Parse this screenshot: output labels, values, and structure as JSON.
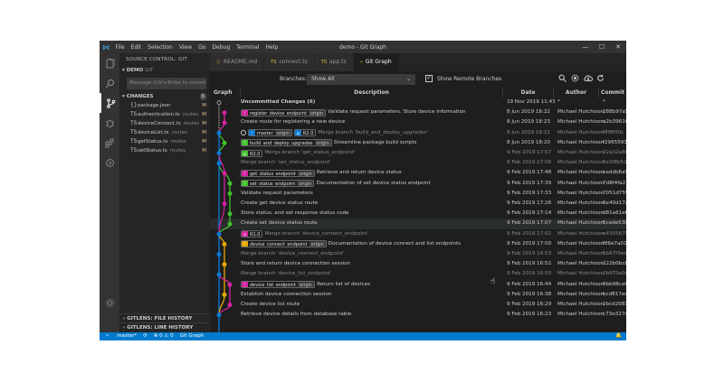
{
  "window": {
    "title": "demo - Git Graph",
    "menu": [
      "File",
      "Edit",
      "Selection",
      "View",
      "Go",
      "Debug",
      "Terminal",
      "Help"
    ],
    "controls": {
      "minimize": "—",
      "maximize": "☐",
      "close": "✕"
    }
  },
  "sidebar": {
    "header": "SOURCE CONTROL: GIT",
    "repo": "DEMO",
    "repo_scm": "GIT",
    "message_placeholder": "Message (Ctrl+Enter to commit",
    "changes_label": "CHANGES",
    "changes_count": "6",
    "files": [
      {
        "name": "package.json",
        "dir": "",
        "status": "M",
        "icon": "{}"
      },
      {
        "name": "authentication.ts",
        "dir": "routes",
        "status": "M",
        "icon": "TS"
      },
      {
        "name": "deviceConnect.ts",
        "dir": "routes",
        "status": "M",
        "icon": "TS"
      },
      {
        "name": "deviceList.ts",
        "dir": "routes",
        "status": "M",
        "icon": "TS"
      },
      {
        "name": "getStatus.ts",
        "dir": "routes",
        "status": "M",
        "icon": "TS"
      },
      {
        "name": "setStatus.ts",
        "dir": "routes",
        "status": "M",
        "icon": "TS"
      }
    ],
    "file_history": "GITLENS: FILE HISTORY",
    "line_history": "GITLENS: LINE HISTORY"
  },
  "tabs": [
    {
      "label": "README.md",
      "icon": "ⓘ",
      "active": false
    },
    {
      "label": "connect.ts",
      "icon": "TS",
      "active": false
    },
    {
      "label": "app.ts",
      "icon": "TS",
      "active": false
    },
    {
      "label": "Git Graph",
      "icon": "⑂",
      "active": true
    }
  ],
  "toolbar": {
    "branches_label": "Branches:",
    "branches_value": "Show All",
    "show_remote_label": "Show Remote Branches",
    "show_remote_checked": "✓"
  },
  "columns": {
    "graph": "Graph",
    "description": "Description",
    "date": "Date",
    "author": "Author",
    "commit": "Commit"
  },
  "colors": {
    "accent": "#007acc",
    "magenta": "#d4229f",
    "green": "#43c02e",
    "yellow": "#e6a700",
    "blue": "#0a7ad6",
    "gray": "#9e9e9e"
  },
  "commits": [
    {
      "desc": "Uncommitted Changes (6)",
      "date": "19 Nov 2019 11:43",
      "author": "*",
      "commit": "*",
      "refs": [],
      "bold": true,
      "dim": false
    },
    {
      "desc": "Validate request parameters. Store device information",
      "date": "8 Jun 2019 18:22",
      "author": "Michael Hutchison",
      "commit": "288b97a5",
      "refs": [
        {
          "name": "register_device_endpoint",
          "origin": "origin",
          "color": "#d4229f"
        }
      ]
    },
    {
      "desc": "Create route for registering a new device",
      "date": "8 Jun 2019 18:23",
      "author": "Michael Hutchison",
      "commit": "a2b39616",
      "refs": []
    },
    {
      "desc": "Merge branch 'build_and_deploy_upgrades'",
      "date": "8 Jun 2019 18:21",
      "author": "Michael Hutchison",
      "commit": "f8f8f00c",
      "refs": [
        {
          "name": "master",
          "origin": "origin",
          "color": "#0a7ad6",
          "head": true
        },
        {
          "name": "R2.0",
          "origin": "",
          "color": "#0a7ad6",
          "tag": true
        }
      ],
      "dim": true
    },
    {
      "desc": "Streamline package build scripts",
      "date": "8 Jun 2019 18:20",
      "author": "Michael Hutchison",
      "commit": "f2965593",
      "refs": [
        {
          "name": "build_and_deploy_upgrades",
          "origin": "origin",
          "color": "#43c02e"
        }
      ]
    },
    {
      "desc": "Merge branch 'get_status_endpoint'",
      "date": "9 Feb 2019 17:57",
      "author": "Michael Hutchison",
      "commit": "22a32a80",
      "refs": [
        {
          "name": "R2.0",
          "origin": "",
          "color": "#43c02e",
          "tag": true
        }
      ],
      "dim": true
    },
    {
      "desc": "Merge branch 'set_status_endpoint'",
      "date": "9 Feb 2019 17:56",
      "author": "Michael Hutchison",
      "commit": "6e3f8b51",
      "refs": [],
      "dim": true
    },
    {
      "desc": "Retrieve and return device status",
      "date": "9 Feb 2019 17:48",
      "author": "Michael Hutchison",
      "commit": "eaddb6a9",
      "refs": [
        {
          "name": "get_status_endpoint",
          "origin": "origin",
          "color": "#d4229f"
        }
      ]
    },
    {
      "desc": "Documentation of set device status endpoint",
      "date": "9 Feb 2019 17:39",
      "author": "Michael Hutchison",
      "commit": "7d8f4fa2",
      "refs": [
        {
          "name": "set_status_endpoint",
          "origin": "origin",
          "color": "#43c02e"
        }
      ]
    },
    {
      "desc": "Validate request parameters",
      "date": "9 Feb 2019 17:33",
      "author": "Michael Hutchison",
      "commit": "7051d755",
      "refs": []
    },
    {
      "desc": "Create get device status route",
      "date": "9 Feb 2019 17:26",
      "author": "Michael Hutchison",
      "commit": "6e40d17a",
      "refs": []
    },
    {
      "desc": "Store status, and set response status code",
      "date": "9 Feb 2019 17:14",
      "author": "Michael Hutchison",
      "commit": "d81a61eb",
      "refs": []
    },
    {
      "desc": "Create set device status route",
      "date": "9 Feb 2019 17:07",
      "author": "Michael Hutchison",
      "commit": "5cede530",
      "refs": [],
      "sel": true
    },
    {
      "desc": "Merge branch 'device_connect_endpoint'",
      "date": "9 Feb 2019 17:02",
      "author": "Michael Hutchison",
      "commit": "e4305675",
      "refs": [
        {
          "name": "R1.0",
          "origin": "",
          "color": "#d4229f",
          "tag": true
        }
      ],
      "dim": true
    },
    {
      "desc": "Documentation of device connect and list endpoints",
      "date": "9 Feb 2019 17:00",
      "author": "Michael Hutchison",
      "commit": "f86e7a01",
      "refs": [
        {
          "name": "device_connect_endpoint",
          "origin": "origin",
          "color": "#e6a700"
        }
      ]
    },
    {
      "desc": "Merge branch 'device_connect_endpoint'",
      "date": "9 Feb 2019 16:53",
      "author": "Michael Hutchison",
      "commit": "5b67f3ed",
      "refs": [],
      "dim": true
    },
    {
      "desc": "Store and return device connection session",
      "date": "9 Feb 2019 16:52",
      "author": "Michael Hutchison",
      "commit": "222b0bcb",
      "refs": []
    },
    {
      "desc": "Merge branch 'device_list_endpoint'",
      "date": "9 Feb 2019 16:50",
      "author": "Michael Hutchison",
      "commit": "2b970a0e",
      "refs": [],
      "dim": true
    },
    {
      "desc": "Return list of devices",
      "date": "9 Feb 2019 16:44",
      "author": "Michael Hutchison",
      "commit": "9bb98caf",
      "refs": [
        {
          "name": "device_list_endpoint",
          "origin": "origin",
          "color": "#d4229f"
        }
      ]
    },
    {
      "desc": "Establish device connection session",
      "date": "9 Feb 2019 16:38",
      "author": "Michael Hutchison",
      "commit": "bcd817ec",
      "refs": []
    },
    {
      "desc": "Create device list route",
      "date": "9 Feb 2019 16:29",
      "author": "Michael Hutchison",
      "commit": "2bcd2083",
      "refs": []
    },
    {
      "desc": "Retrieve device details from database table",
      "date": "9 Feb 2019 16:23",
      "author": "Michael Hutchison",
      "commit": "c73e327d",
      "refs": []
    }
  ],
  "statusbar": {
    "branch": "master*",
    "sync": "⟳",
    "problems": "⊗ 0 ⚠ 0",
    "gitgraph": "Git Graph",
    "bell": "🔔"
  }
}
